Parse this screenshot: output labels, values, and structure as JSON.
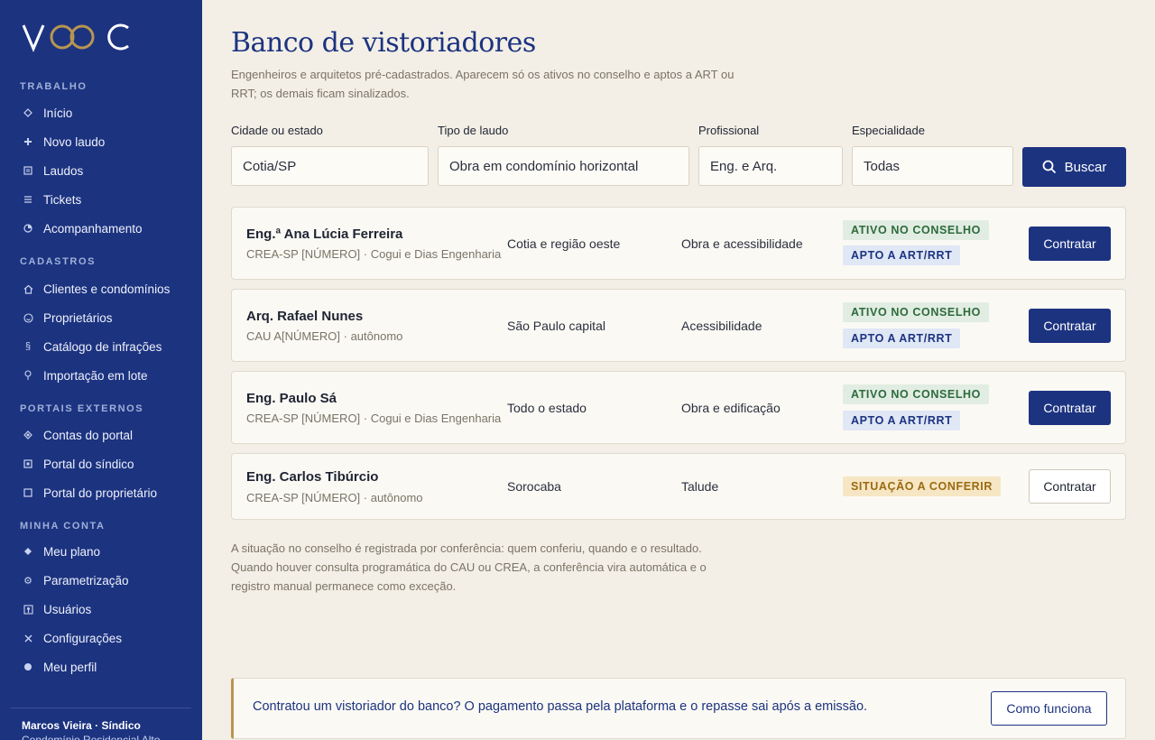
{
  "brand": {
    "logo_text": "VOOC",
    "accent_color": "#b89550",
    "primary_color": "#1c3380"
  },
  "sidebar": {
    "sections": [
      {
        "title": "TRABALHO",
        "items": [
          {
            "label": "Início",
            "icon": "diamond-icon"
          },
          {
            "label": "Novo laudo",
            "icon": "plus-icon"
          },
          {
            "label": "Laudos",
            "icon": "list-icon"
          },
          {
            "label": "Tickets",
            "icon": "menu-icon"
          },
          {
            "label": "Acompanhamento",
            "icon": "clock-icon"
          }
        ]
      },
      {
        "title": "CADASTROS",
        "items": [
          {
            "label": "Clientes e condomínios",
            "icon": "home-icon"
          },
          {
            "label": "Proprietários",
            "icon": "person-icon"
          },
          {
            "label": "Catálogo de infrações",
            "icon": "section-icon"
          },
          {
            "label": "Importação em lote",
            "icon": "upload-icon"
          }
        ]
      },
      {
        "title": "PORTAIS EXTERNOS",
        "items": [
          {
            "label": "Contas do portal",
            "icon": "diamond-filled-icon"
          },
          {
            "label": "Portal do síndico",
            "icon": "square-dot-icon"
          },
          {
            "label": "Portal do proprietário",
            "icon": "square-icon"
          }
        ]
      },
      {
        "title": "MINHA CONTA",
        "items": [
          {
            "label": "Meu plano",
            "icon": "diamond-solid-icon"
          },
          {
            "label": "Parametrização",
            "icon": "gear-icon"
          },
          {
            "label": "Usuários",
            "icon": "users-icon"
          },
          {
            "label": "Configurações",
            "icon": "tools-icon"
          },
          {
            "label": "Meu perfil",
            "icon": "dot-icon"
          }
        ]
      }
    ],
    "user": {
      "name": "Marcos Vieira · Síndico",
      "org": "Condomínio Residencial Alto"
    }
  },
  "page": {
    "title": "Banco de vistoriadores",
    "subtitle": "Engenheiros e arquitetos pré-cadastrados. Aparecem só os ativos no conselho e aptos a ART ou RRT; os demais ficam sinalizados."
  },
  "filters": {
    "city": {
      "label": "Cidade ou estado",
      "value": "Cotia/SP"
    },
    "type": {
      "label": "Tipo de laudo",
      "value": "Obra em condomínio horizontal"
    },
    "professional": {
      "label": "Profissional",
      "value": "Eng. e Arq."
    },
    "specialty": {
      "label": "Especialidade",
      "value": "Todas"
    },
    "search_label": "Buscar"
  },
  "inspectors": [
    {
      "name": "Eng.ª Ana Lúcia Ferreira",
      "registry": "CREA-SP [NÚMERO] · Cogui e Dias Engenharia",
      "region": "Cotia e região oeste",
      "specialty": "Obra e acessibilidade",
      "badges": [
        "ATIVO NO CONSELHO",
        "APTO A ART/RRT"
      ],
      "action": "Contratar"
    },
    {
      "name": "Arq. Rafael Nunes",
      "registry": "CAU A[NÚMERO] · autônomo",
      "region": "São Paulo capital",
      "specialty": "Acessibilidade",
      "badges": [
        "ATIVO NO CONSELHO",
        "APTO A ART/RRT"
      ],
      "action": "Contratar"
    },
    {
      "name": "Eng. Paulo Sá",
      "registry": "CREA-SP [NÚMERO] · Cogui e Dias Engenharia",
      "region": "Todo o estado",
      "specialty": "Obra e edificação",
      "badges": [
        "ATIVO NO CONSELHO",
        "APTO A ART/RRT"
      ],
      "action": "Contratar"
    },
    {
      "name": "Eng. Carlos Tibúrcio",
      "registry": "CREA-SP [NÚMERO] · autônomo",
      "region": "Sorocaba",
      "specialty": "Talude",
      "badges": [
        "SITUAÇÃO A CONFERIR"
      ],
      "action": "Contratar"
    }
  ],
  "note": "A situação no conselho é registrada por conferência: quem conferiu, quando e o resultado. Quando houver consulta programática do CAU ou CREA, a conferência vira automática e o registro manual permanece como exceção.",
  "banner": {
    "text": "Contratou um vistoriador do banco? O pagamento passa pela plataforma e o repasse sai após a emissão.",
    "button": "Como funciona"
  }
}
